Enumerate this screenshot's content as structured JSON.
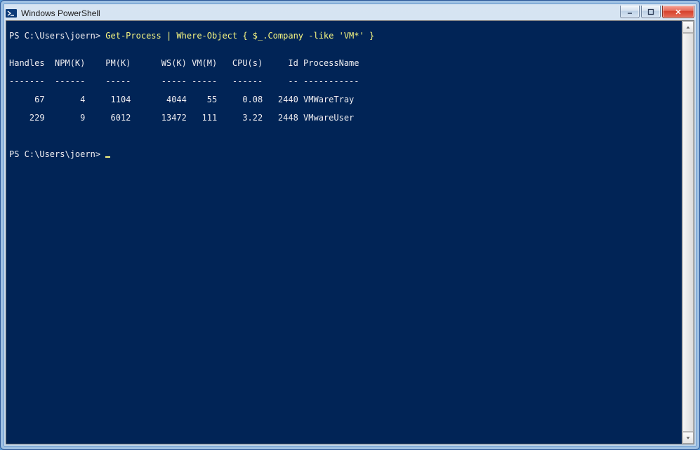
{
  "window": {
    "title": "Windows PowerShell"
  },
  "terminal": {
    "prompt1_prefix": "PS C:\\Users\\joern>",
    "command1": " Get-Process | Where-Object { $_.Company -like 'VM*' }",
    "blank": "",
    "headers": "Handles  NPM(K)    PM(K)      WS(K) VM(M)   CPU(s)     Id ProcessName",
    "divider": "-------  ------    -----      ----- -----   ------     -- -----------",
    "rows": [
      "     67       4     1104       4044    55     0.08   2440 VMWareTray",
      "    229       9     6012      13472   111     3.22   2448 VMwareUser"
    ],
    "prompt2_prefix": "PS C:\\Users\\joern>",
    "prompt2_space": " "
  },
  "controls": {
    "minimize": "–",
    "maximize": "▢",
    "close": "✕",
    "scroll_up": "▲",
    "scroll_down": "▼"
  }
}
